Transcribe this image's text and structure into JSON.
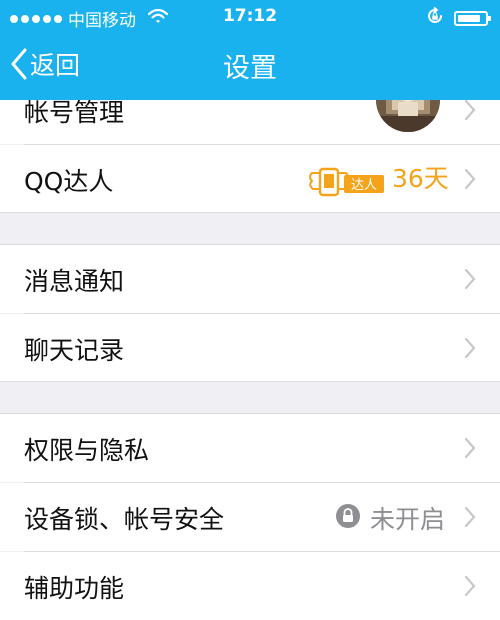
{
  "status_bar": {
    "carrier": "中国移动",
    "time": "17:12",
    "battery_level": 0.85
  },
  "nav": {
    "back_label": "返回",
    "title": "设置"
  },
  "sections": [
    {
      "items": [
        {
          "label": "帐号管理"
        },
        {
          "label": "QQ达人",
          "badge_text": "达人",
          "value": "36天"
        }
      ]
    },
    {
      "items": [
        {
          "label": "消息通知"
        },
        {
          "label": "聊天记录"
        }
      ]
    },
    {
      "items": [
        {
          "label": "权限与隐私"
        },
        {
          "label": "设备锁、帐号安全",
          "value": "未开启"
        },
        {
          "label": "辅助功能"
        }
      ]
    }
  ],
  "colors": {
    "nav_bg": "#19b2ef",
    "accent_orange": "#f5a31a",
    "muted_gray": "#8e8e93",
    "page_bg": "#efeff4"
  },
  "icons": [
    "signal-dots-icon",
    "wifi-icon",
    "rotation-lock-icon",
    "battery-icon",
    "back-chevron-icon",
    "chevron-right-icon",
    "daren-badge-icon",
    "lock-icon"
  ]
}
